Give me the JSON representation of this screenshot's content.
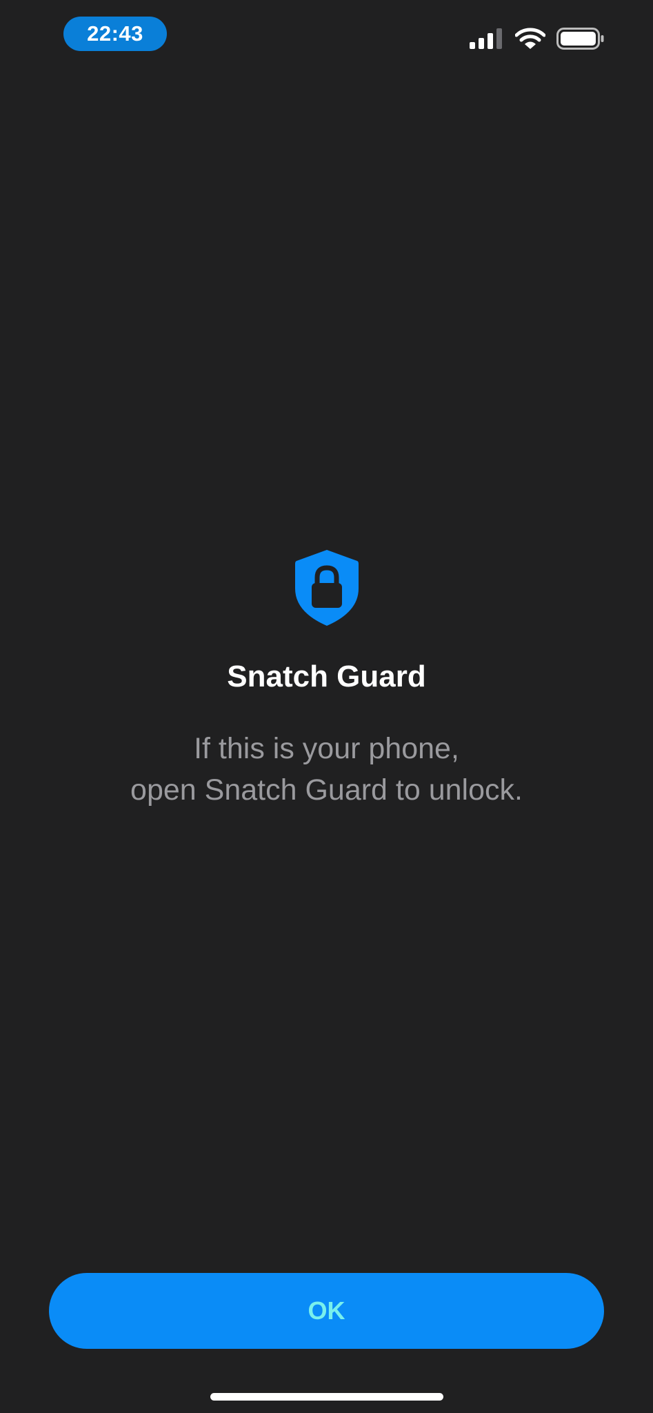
{
  "status_bar": {
    "time": "22:43",
    "signal_icon": "cellular-signal-icon",
    "wifi_icon": "wifi-icon",
    "battery_icon": "battery-icon"
  },
  "guard": {
    "icon": "shield-lock-icon",
    "title": "Snatch Guard",
    "message_line1": "If this is your phone,",
    "message_line2": "open Snatch Guard to unlock."
  },
  "actions": {
    "ok_label": "OK"
  },
  "colors": {
    "background": "#202021",
    "accent": "#0a8cf7",
    "time_pill": "#0a7fd8",
    "button_text": "#79f0ec",
    "secondary_text": "#9a9a9e"
  }
}
